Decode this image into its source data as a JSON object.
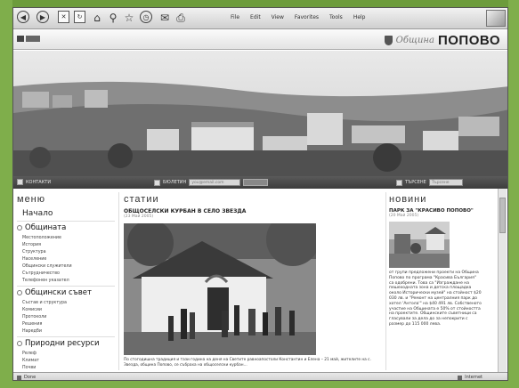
{
  "browser": {
    "menu": [
      "File",
      "Edit",
      "View",
      "Favorites",
      "Tools",
      "Help"
    ]
  },
  "site": {
    "brand_prefix": "Община",
    "brand_name": "ПОПОВО"
  },
  "navstrip": {
    "contacts_label": "КОНТАКТИ",
    "newsletter_label": "БЮЛЕТИН",
    "newsletter_placeholder": "you@email.com",
    "search_label": "ТЪРСЕНЕ",
    "search_placeholder": "Търсене"
  },
  "menu": {
    "heading": "меню",
    "home": "Начало",
    "groups": [
      {
        "label": "Общината",
        "items": [
          "Местоположение",
          "История",
          "Структура",
          "Население",
          "Общински служители",
          "Сътрудничество",
          "Телефонен указател"
        ]
      },
      {
        "label": "Общински съвет",
        "items": [
          "Състав и структура",
          "Комисии",
          "Протоколи",
          "Решения",
          "Наредби"
        ]
      },
      {
        "label": "Природни ресурси",
        "items": [
          "Релеф",
          "Климат",
          "Почви"
        ]
      }
    ]
  },
  "articles": {
    "heading": "статии",
    "title": "ОБЩОСЕЛСКИ КУРБАН В СЕЛО ЗВЕЗДА",
    "date": "(23 Май 2005)",
    "text": "По стогодишна традиция и тази година на деня на Светите равноапостоли Константин и Елена – 21 май, жителите на с. Звезда, община Попово, се събраха на общоселски курбан..."
  },
  "news": {
    "heading": "новини",
    "title": "ПАРК ЗА \"КРАСИВО ПОПОВО\"",
    "date": "(20 Май 2005)",
    "text": "от групи предложени проекти на Община Попово по програма \"Красива България\" са одобрени. Това са \"Изграждане на пешеходната зона и детска площадка около Исторически музей\" на стойност $20 030 лв. и \"Ремонт на централния парк до хотел 'Антола'\" на $40 491 лв. Собственото участие на Общината е 50% от стойността на проектите. Общинските съветници са гласували за дела до за непокрити с размер до 115 000 лева."
  },
  "status": {
    "left": "Done",
    "zone": "Internet"
  }
}
